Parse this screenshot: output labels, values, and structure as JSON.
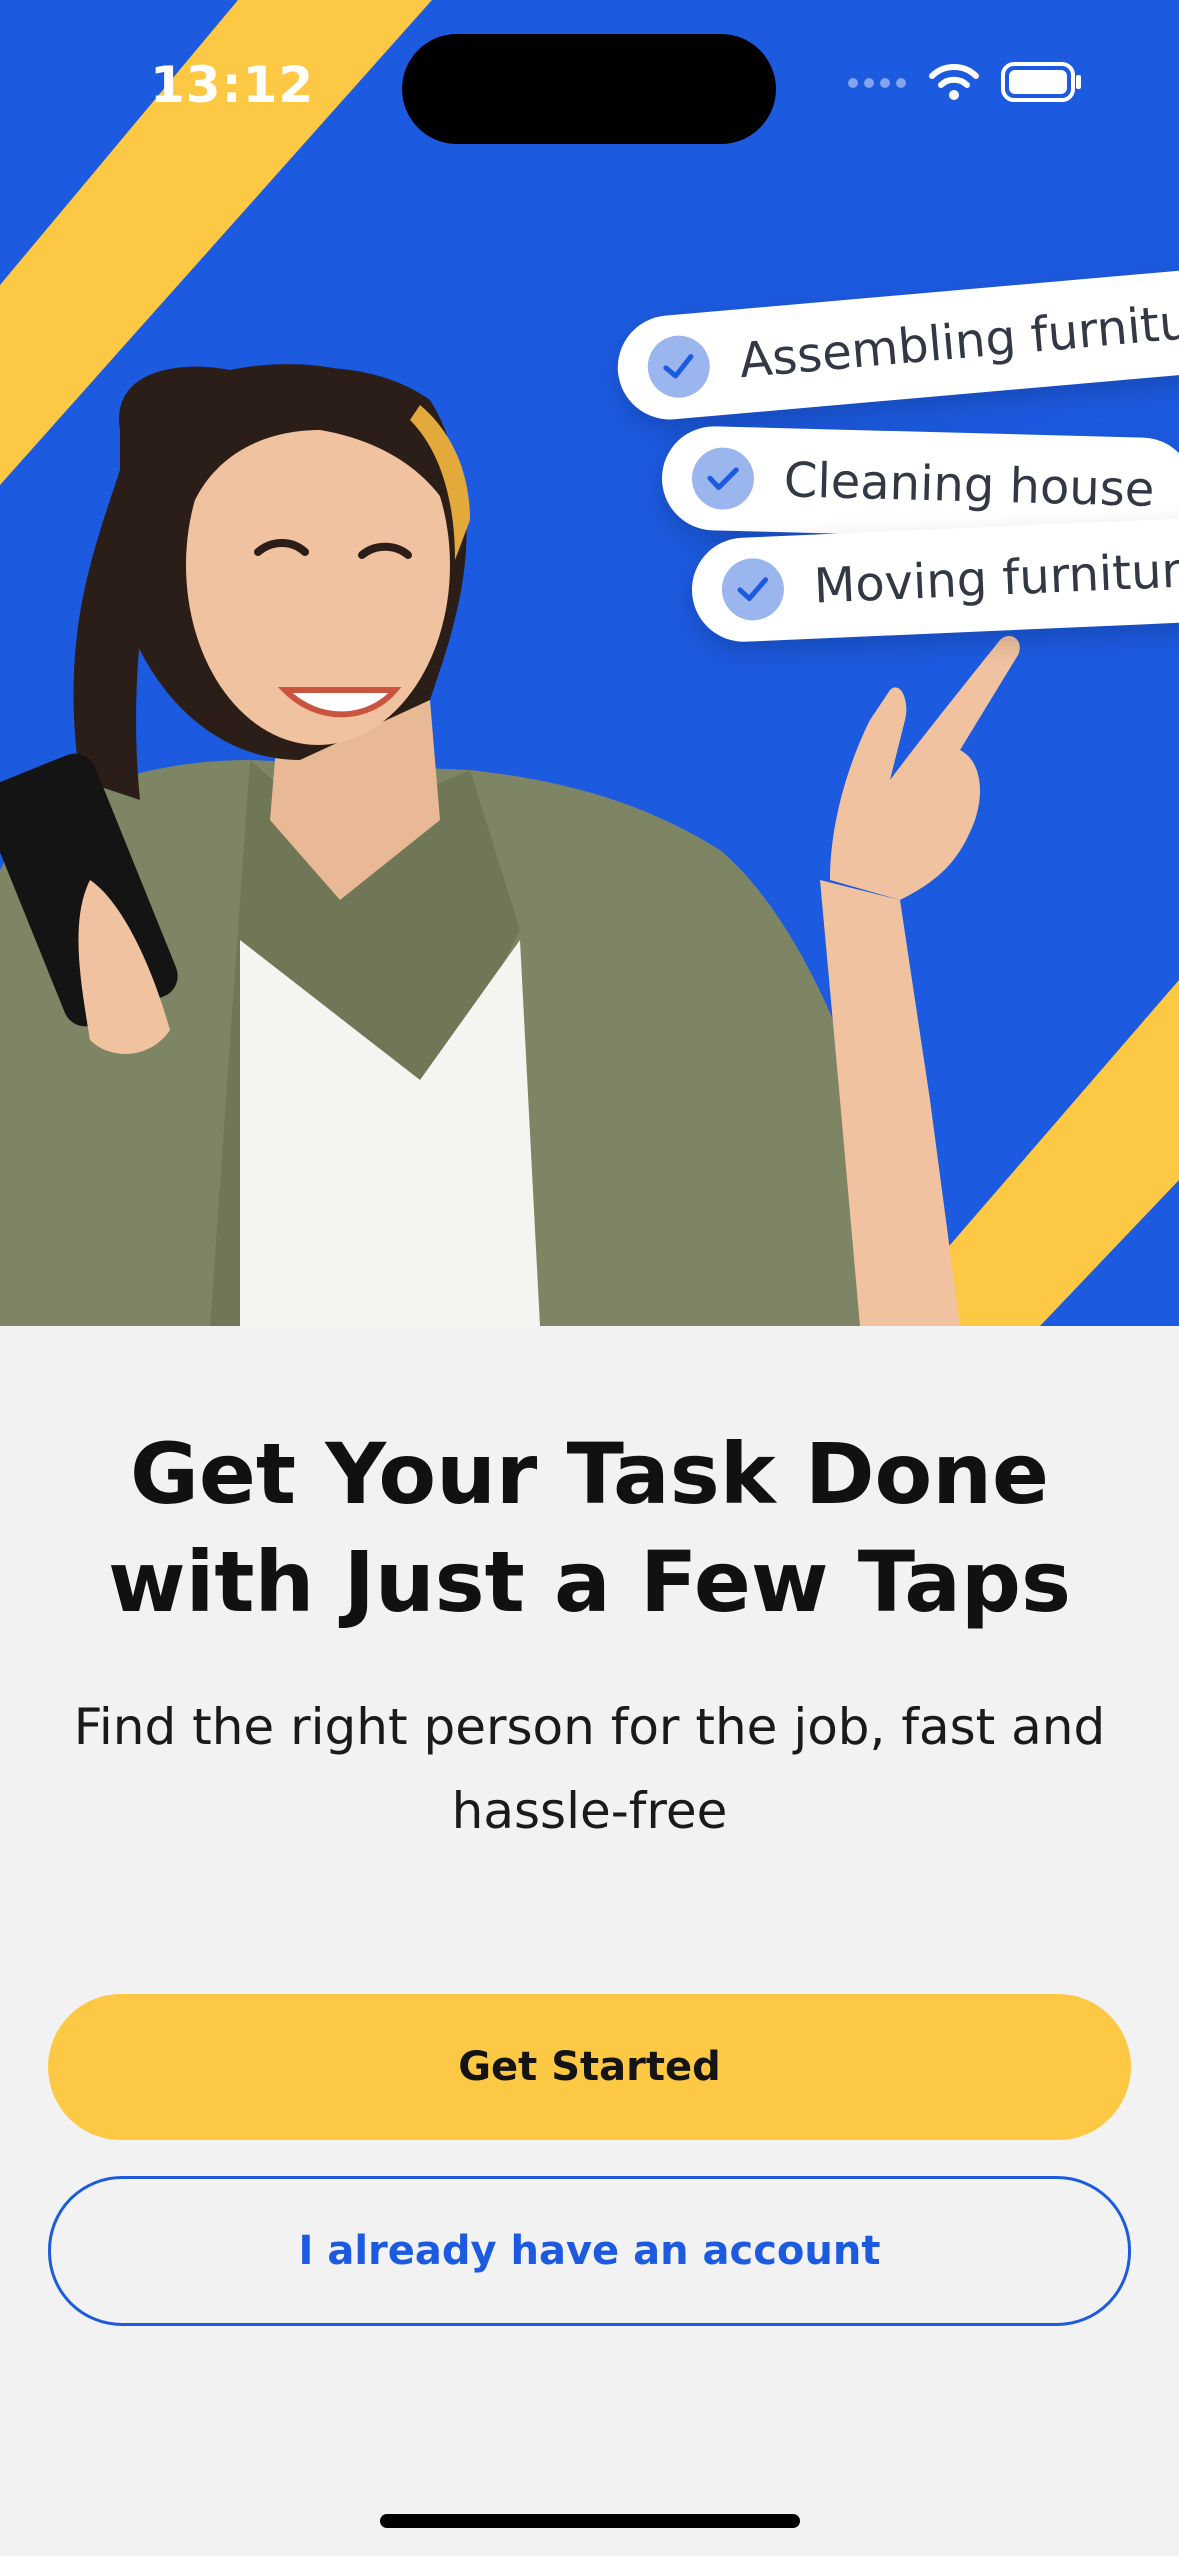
{
  "status_bar": {
    "time": "13:12",
    "signal_icon": "cellular-signal-icon",
    "wifi_icon": "wifi-icon",
    "battery_icon": "battery-icon"
  },
  "hero": {
    "background_color": "#1c5ae0",
    "stripe_color": "#fdc844",
    "tasks": [
      {
        "label": "Assembling furniture",
        "icon": "check-icon"
      },
      {
        "label": "Cleaning house",
        "icon": "check-icon"
      },
      {
        "label": "Moving furniture",
        "icon": "check-icon"
      }
    ]
  },
  "onboarding": {
    "title": "Get Your Task Done with Just a Few Taps",
    "subtitle": "Find the right person for the job, fast and hassle-free"
  },
  "actions": {
    "primary_label": "Get Started",
    "secondary_label": "I already have an account"
  },
  "colors": {
    "accent_blue": "#1c5ae0",
    "accent_yellow": "#fdc844",
    "background": "#f2f2f2"
  }
}
